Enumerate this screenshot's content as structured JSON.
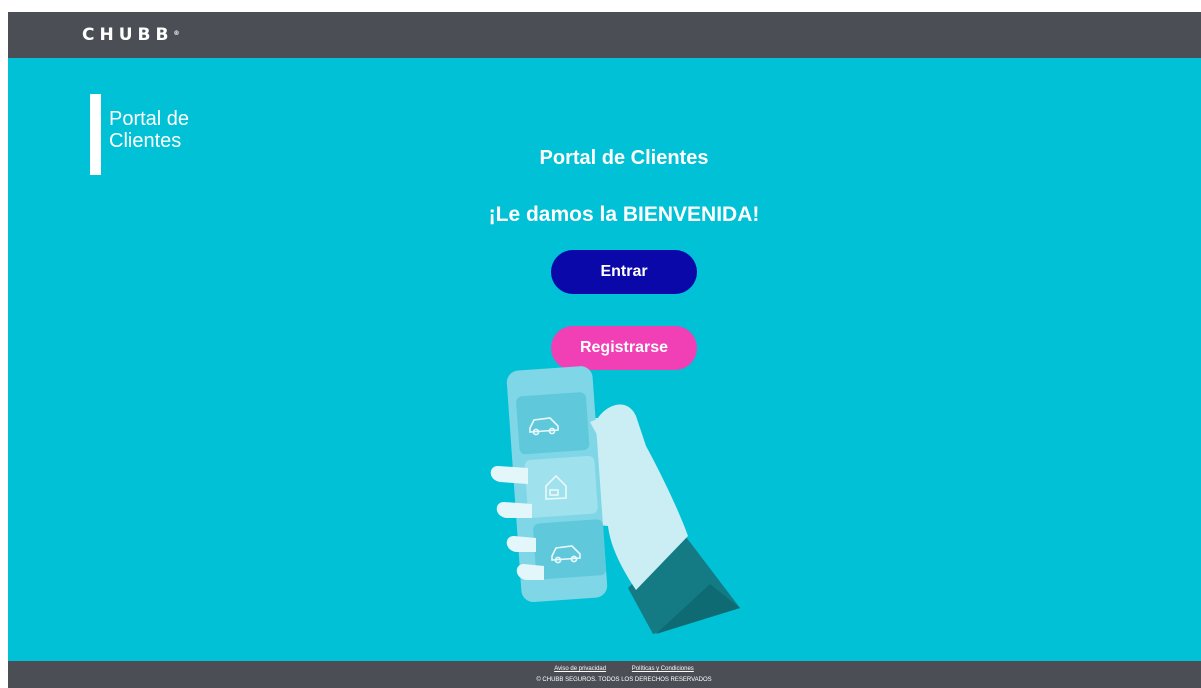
{
  "header": {
    "logo": "CHUBB",
    "logo_mark": "®"
  },
  "side_brand": {
    "label": "Portal de Clientes"
  },
  "main": {
    "title": "Portal de Clientes",
    "welcome": "¡Le damos la BIENVENIDA!",
    "enter_label": "Entrar",
    "register_label": "Registrarse"
  },
  "illustration": {
    "icons": [
      "car-icon",
      "home-icon",
      "car-icon"
    ]
  },
  "footer": {
    "privacy_link": "Aviso de privacidad",
    "policies_link": "Políticas y Condiciones",
    "copyright": "© CHUBB SEGUROS. TODOS LOS DERECHOS RESERVADOS"
  },
  "colors": {
    "header_bg": "#4b4f55",
    "main_bg": "#00c1d5",
    "enter_button": "#0a08a8",
    "register_button": "#f13fb6"
  }
}
